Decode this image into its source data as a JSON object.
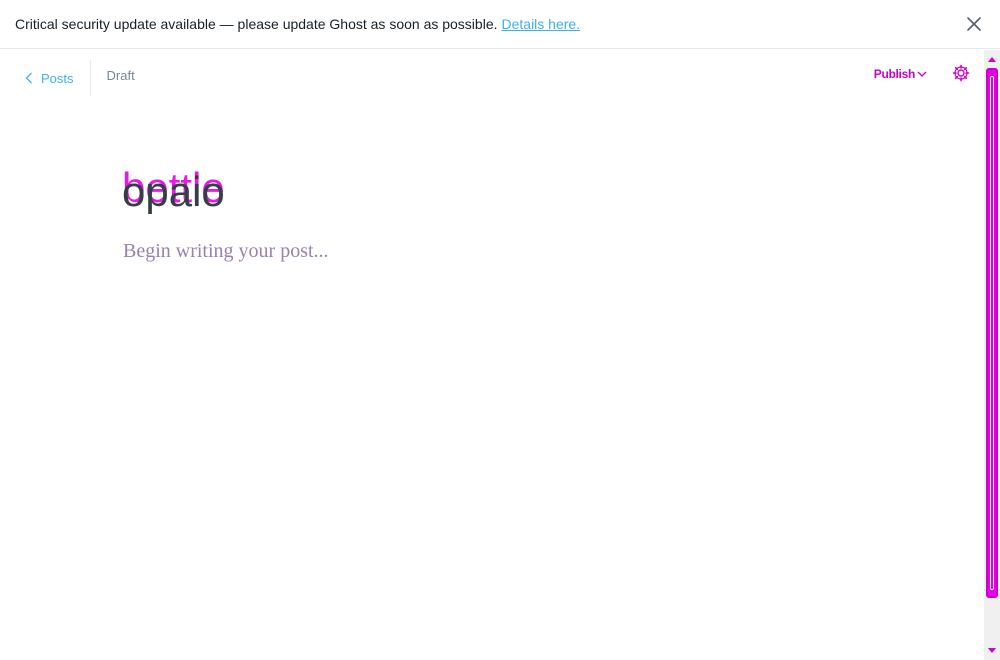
{
  "alert": {
    "message": "Critical security update available — please update Ghost as soon as possible.",
    "link_label": "Details here.",
    "close_icon": "close-icon"
  },
  "header": {
    "back_label": "Posts",
    "back_icon": "chevron-left-icon",
    "status": "Draft",
    "publish_label": "Publish",
    "publish_icon": "chevron-down-icon",
    "settings_icon": "gear-icon"
  },
  "editor": {
    "title_value": "opaio",
    "title_overlay": "bettle",
    "body_placeholder": "Begin writing your post..."
  },
  "colors": {
    "accent": "#3eb0ef",
    "highlight": "#e600e6",
    "text": "#15212a",
    "muted": "#738a94"
  }
}
